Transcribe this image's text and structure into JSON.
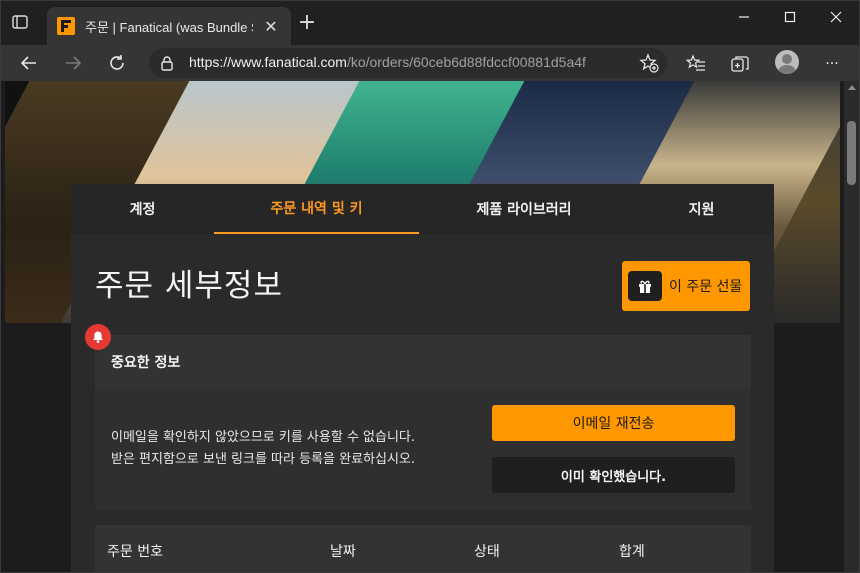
{
  "browser": {
    "tab_title": "주문 | Fanatical (was Bundle Stars)",
    "tab_close": "✕",
    "new_tab": "+",
    "url_host": "https://www.fanatical.com",
    "url_path": "/ko/orders/60ceb6d88fdccf00881d5a4f",
    "window_controls": {
      "minimize": "—",
      "maximize": "☐",
      "close": "✕"
    },
    "more_menu": "···"
  },
  "nav_tabs": [
    {
      "label": "계정",
      "active": false
    },
    {
      "label": "주문 내역 및 키",
      "active": true
    },
    {
      "label": "제품 라이브러리",
      "active": false
    },
    {
      "label": "지원",
      "active": false
    }
  ],
  "page": {
    "title": "주문 세부정보",
    "gift_button": "이 주문 선물"
  },
  "notice": {
    "heading": "중요한 정보",
    "line1": "이메일을 확인하지 않았으므로 키를 사용할 수 없습니다.",
    "line2": "받은 편지함으로 보낸 링크를 따라 등록을 완료하십시오.",
    "resend_button": "이메일 재전송",
    "confirmed_button": "이미 확인했습니다."
  },
  "order_table": {
    "columns": [
      "주문 번호",
      "날짜",
      "상태",
      "합계"
    ]
  },
  "colors": {
    "accent": "#ff9800",
    "alert": "#e53935",
    "panel": "#2a2a2a"
  }
}
